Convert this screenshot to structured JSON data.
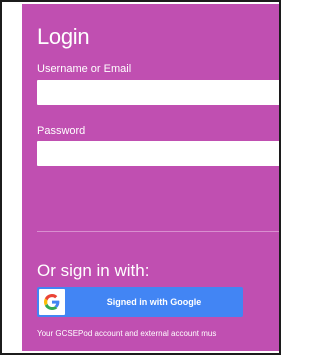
{
  "login": {
    "title": "Login",
    "username_label": "Username or Email",
    "username_value": "",
    "password_label": "Password",
    "password_value": ""
  },
  "alt_login": {
    "title": "Or sign in with:",
    "google_button_label": "Signed in with Google",
    "google_icon": "google-g-icon"
  },
  "footer_note": "Your GCSEPod account and external account mus",
  "colors": {
    "panel_background": "#c04fb1",
    "google_button": "#4285f4",
    "text": "#ffffff"
  }
}
